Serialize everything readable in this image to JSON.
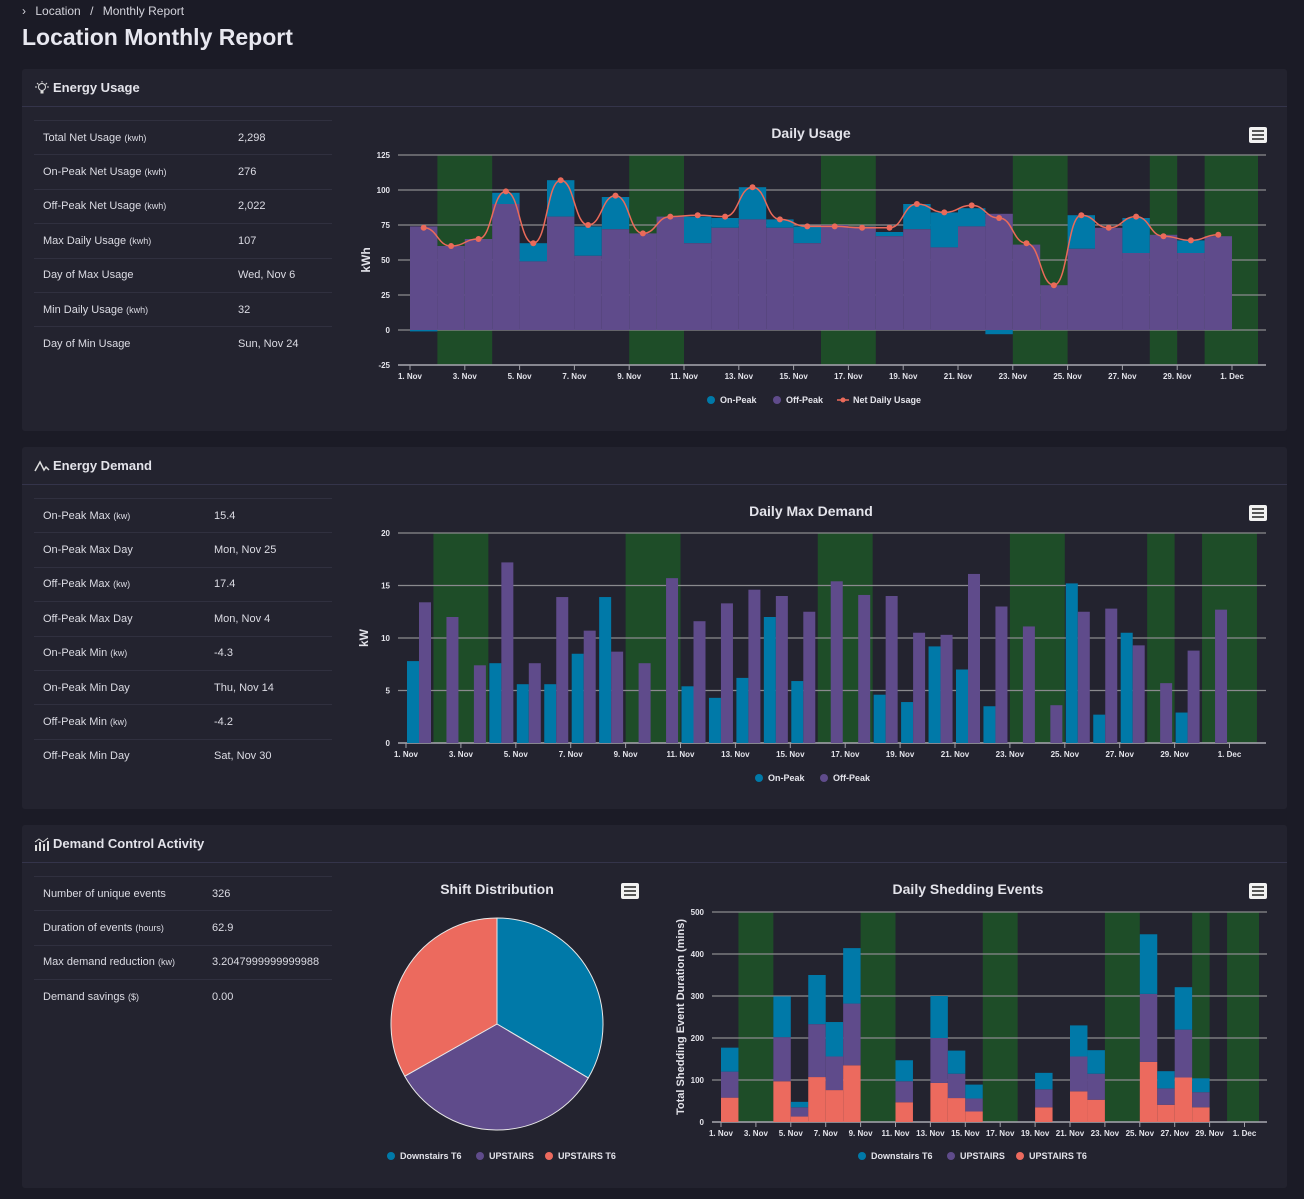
{
  "breadcrumb": {
    "items": [
      "Location",
      "Monthly Report"
    ]
  },
  "page_title": "Location Monthly Report",
  "energy_usage": {
    "title": "Energy Usage",
    "stats": [
      {
        "label": "Total Net Usage",
        "unit": "(kwh)",
        "value": "2,298"
      },
      {
        "label": "On-Peak Net Usage",
        "unit": "(kwh)",
        "value": "276"
      },
      {
        "label": "Off-Peak Net Usage",
        "unit": "(kwh)",
        "value": "2,022"
      },
      {
        "label": "Max Daily Usage",
        "unit": "(kwh)",
        "value": "107"
      },
      {
        "label": "Day of Max Usage",
        "unit": "",
        "value": "Wed, Nov 6"
      },
      {
        "label": "Min Daily Usage",
        "unit": "(kwh)",
        "value": "32"
      },
      {
        "label": "Day of Min Usage",
        "unit": "",
        "value": "Sun, Nov 24"
      }
    ]
  },
  "energy_demand": {
    "title": "Energy Demand",
    "stats": [
      {
        "label": "On-Peak Max",
        "unit": "(kw)",
        "value": "15.4"
      },
      {
        "label": "On-Peak Max Day",
        "unit": "",
        "value": "Mon, Nov 25"
      },
      {
        "label": "Off-Peak Max",
        "unit": "(kw)",
        "value": "17.4"
      },
      {
        "label": "Off-Peak Max Day",
        "unit": "",
        "value": "Mon, Nov 4"
      },
      {
        "label": "On-Peak Min",
        "unit": "(kw)",
        "value": "-4.3"
      },
      {
        "label": "On-Peak Min Day",
        "unit": "",
        "value": "Thu, Nov 14"
      },
      {
        "label": "Off-Peak Min",
        "unit": "(kw)",
        "value": "-4.2"
      },
      {
        "label": "Off-Peak Min Day",
        "unit": "",
        "value": "Sat, Nov 30"
      }
    ]
  },
  "demand_control": {
    "title": "Demand Control Activity",
    "stats": [
      {
        "label": "Number of unique events",
        "unit": "",
        "value": "326"
      },
      {
        "label": "Duration of events",
        "unit": "(hours)",
        "value": "62.9"
      },
      {
        "label": "Max demand reduction",
        "unit": "(kw)",
        "value": "3.2047999999999988"
      },
      {
        "label": "Demand savings",
        "unit": "($)",
        "value": "0.00"
      }
    ]
  },
  "colors": {
    "on_peak": "#0079a8",
    "off_peak": "#5f4b8b",
    "net": "#ea6a5a",
    "weekend": "#1e4d28",
    "upstairs_t6": "#ec6a5e"
  },
  "chart_data": [
    {
      "id": "daily-usage",
      "type": "bar",
      "title": "Daily Usage",
      "ylabel": "kWh",
      "ylim": [
        -25,
        125
      ],
      "yticks": [
        -25,
        0,
        25,
        50,
        75,
        100,
        125
      ],
      "xticks": [
        "1. Nov",
        "3. Nov",
        "5. Nov",
        "7. Nov",
        "9. Nov",
        "11. Nov",
        "13. Nov",
        "15. Nov",
        "17. Nov",
        "19. Nov",
        "21. Nov",
        "23. Nov",
        "25. Nov",
        "27. Nov",
        "29. Nov",
        "1. Dec"
      ],
      "weekend_bands": [
        [
          2,
          4
        ],
        [
          9,
          11
        ],
        [
          16,
          18
        ],
        [
          23,
          25
        ],
        [
          28,
          29
        ],
        [
          30,
          32
        ]
      ],
      "days": [
        1,
        2,
        3,
        4,
        5,
        6,
        7,
        8,
        9,
        10,
        11,
        12,
        13,
        14,
        15,
        16,
        17,
        18,
        19,
        20,
        21,
        22,
        23,
        24,
        25,
        26,
        27,
        28,
        29,
        30
      ],
      "series": [
        {
          "name": "Off-Peak",
          "values": [
            74,
            60,
            65,
            90,
            49,
            81,
            53,
            72,
            69,
            81,
            62,
            73,
            79,
            73,
            62,
            75,
            74,
            67,
            72,
            59,
            74,
            83,
            61,
            32,
            58,
            73,
            55,
            68,
            55,
            67
          ]
        },
        {
          "name": "On-Peak",
          "values": [
            -1,
            0,
            0,
            8,
            13,
            26,
            21,
            23,
            0,
            0,
            19,
            7,
            23,
            6,
            12,
            0,
            0,
            3,
            18,
            25,
            13,
            -3,
            0,
            0,
            24,
            0,
            25,
            0,
            9,
            0
          ]
        },
        {
          "name": "Net Daily Usage",
          "values": [
            73,
            60,
            65,
            99,
            62,
            107,
            75,
            96,
            69,
            81,
            82,
            81,
            102,
            79,
            74,
            74,
            73,
            73,
            90,
            84,
            89,
            80,
            62,
            32,
            82,
            73,
            81,
            67,
            64,
            68
          ]
        }
      ],
      "legend": [
        "On-Peak",
        "Off-Peak",
        "Net Daily Usage"
      ]
    },
    {
      "id": "daily-max-demand",
      "type": "bar",
      "title": "Daily Max Demand",
      "ylabel": "kW",
      "ylim": [
        0,
        20
      ],
      "yticks": [
        0,
        5,
        10,
        15,
        20
      ],
      "xticks": [
        "1. Nov",
        "3. Nov",
        "5. Nov",
        "7. Nov",
        "9. Nov",
        "11. Nov",
        "13. Nov",
        "15. Nov",
        "17. Nov",
        "19. Nov",
        "21. Nov",
        "23. Nov",
        "25. Nov",
        "27. Nov",
        "29. Nov",
        "1. Dec"
      ],
      "weekend_bands": [
        [
          2,
          4
        ],
        [
          9,
          11
        ],
        [
          16,
          18
        ],
        [
          23,
          25
        ],
        [
          28,
          29
        ],
        [
          30,
          32
        ]
      ],
      "series": [
        {
          "name": "On-Peak",
          "values": [
            7.8,
            0,
            0,
            7.6,
            5.6,
            5.6,
            8.5,
            13.9,
            0,
            0,
            5.4,
            4.3,
            6.2,
            12.0,
            5.9,
            0,
            0,
            4.6,
            3.9,
            9.2,
            7.0,
            3.5,
            0,
            0,
            15.2,
            2.7,
            10.5,
            0,
            2.9,
            0
          ]
        },
        {
          "name": "Off-Peak",
          "values": [
            13.4,
            12.0,
            7.4,
            17.2,
            7.6,
            13.9,
            10.7,
            8.7,
            7.6,
            15.7,
            11.6,
            13.3,
            14.6,
            14.0,
            12.5,
            15.4,
            14.1,
            14.0,
            10.5,
            10.3,
            16.1,
            13.0,
            11.1,
            3.6,
            12.5,
            12.8,
            9.3,
            5.7,
            8.8,
            12.7
          ]
        }
      ],
      "legend": [
        "On-Peak",
        "Off-Peak"
      ]
    },
    {
      "id": "shift-distribution",
      "type": "pie",
      "title": "Shift Distribution",
      "slices": [
        {
          "name": "Downstairs T6",
          "value": 33.5
        },
        {
          "name": "UPSTAIRS",
          "value": 33.3
        },
        {
          "name": "UPSTAIRS T6",
          "value": 33.2
        }
      ],
      "legend": [
        "Downstairs T6",
        "UPSTAIRS",
        "UPSTAIRS T6"
      ]
    },
    {
      "id": "daily-shedding-events",
      "type": "bar",
      "stacked": true,
      "title": "Daily Shedding Events",
      "ylabel": "Total Shedding Event Duration (mins)",
      "ylim": [
        0,
        500
      ],
      "yticks": [
        0,
        100,
        200,
        300,
        400,
        500
      ],
      "xticks": [
        "1. Nov",
        "3. Nov",
        "5. Nov",
        "7. Nov",
        "9. Nov",
        "11. Nov",
        "13. Nov",
        "15. Nov",
        "17. Nov",
        "19. Nov",
        "21. Nov",
        "23. Nov",
        "25. Nov",
        "27. Nov",
        "29. Nov",
        "1. Dec"
      ],
      "weekend_bands": [
        [
          2,
          4
        ],
        [
          9,
          11
        ],
        [
          16,
          18
        ],
        [
          23,
          25
        ],
        [
          28,
          29
        ],
        [
          30,
          32
        ]
      ],
      "series": [
        {
          "name": "UPSTAIRS T6",
          "values": [
            58,
            0,
            0,
            97,
            13,
            107,
            76,
            135,
            0,
            0,
            47,
            0,
            93,
            57,
            25,
            0,
            0,
            0,
            35,
            0,
            73,
            53,
            0,
            0,
            143,
            41,
            106,
            35,
            0,
            0
          ]
        },
        {
          "name": "UPSTAIRS",
          "values": [
            62,
            0,
            0,
            105,
            22,
            126,
            80,
            147,
            0,
            0,
            50,
            0,
            107,
            58,
            31,
            0,
            0,
            0,
            43,
            0,
            83,
            62,
            0,
            0,
            162,
            39,
            114,
            36,
            0,
            0
          ]
        },
        {
          "name": "Downstairs T6",
          "values": [
            57,
            0,
            0,
            97,
            13,
            117,
            82,
            132,
            0,
            0,
            50,
            0,
            100,
            55,
            33,
            0,
            0,
            0,
            39,
            0,
            74,
            56,
            0,
            0,
            142,
            41,
            101,
            33,
            0,
            0
          ]
        }
      ],
      "legend": [
        "Downstairs T6",
        "UPSTAIRS",
        "UPSTAIRS T6"
      ]
    }
  ]
}
